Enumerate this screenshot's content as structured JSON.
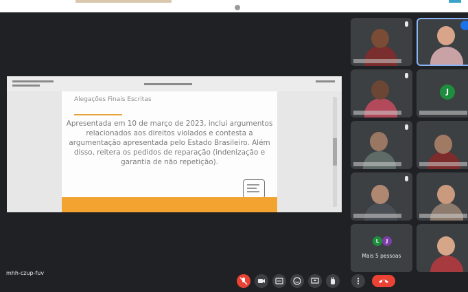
{
  "colors": {
    "meet_background": "#202124",
    "tile_background": "#3c4043",
    "danger_red": "#ea4335",
    "slide_accent_orange": "#f3a330",
    "avatar_green": "#1e8e3e",
    "avatar_purple": "#7b3fa6"
  },
  "slide": {
    "heading": "Alegações Finais Escritas",
    "body": "Apresentada em 10 de março de 2023, inclui argumentos relacionados aos direitos violados e contesta a argumentação apresentada pelo Estado Brasileiro. Além disso, reitera os pedidos de reparação (indenização e garantia de não repetição)."
  },
  "participants": {
    "tile_j_initial": "J",
    "more_tile": {
      "avatar_1": "L",
      "avatar_2": "J",
      "label": "Mais 5 pessoas"
    }
  },
  "bottom_bar": {
    "meeting_code": "mhh-czup-fuv",
    "icons": [
      "mic-off-icon",
      "camera-icon",
      "captions-icon",
      "emoji-icon",
      "present-icon",
      "raise-hand-icon",
      "more-options-icon",
      "end-call-icon"
    ]
  }
}
